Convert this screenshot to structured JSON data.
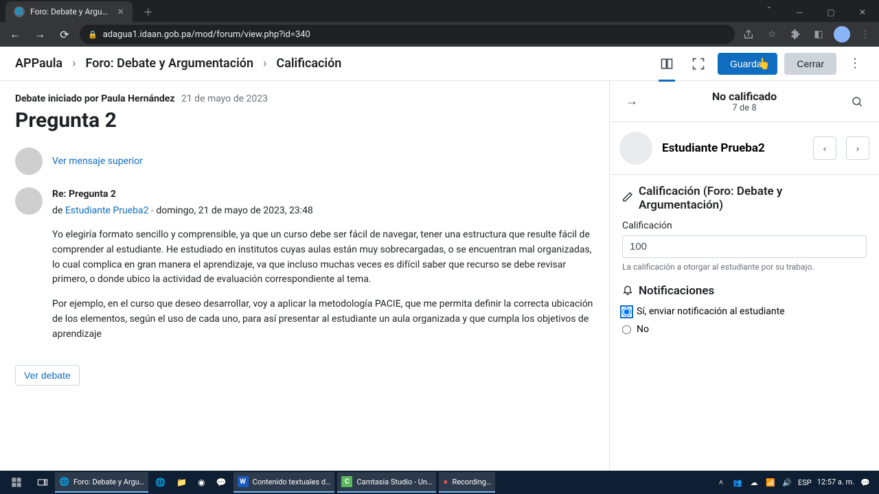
{
  "browser": {
    "tab_title": "Foro: Debate y Argu…",
    "url": "adagua1.idaan.gob.pa/mod/forum/view.php?id=340"
  },
  "breadcrumb": {
    "course": "APPaula",
    "activity": "Foro: Debate y Argumentación",
    "page": "Calificación"
  },
  "actions": {
    "save": "Guardar",
    "close": "Cerrar"
  },
  "debate": {
    "starter_label": "Debate iniciado por Paula Hernández",
    "start_date": "21 de mayo de 2023",
    "title": "Pregunta 2",
    "view_parent": "Ver mensaje superior"
  },
  "post": {
    "subject": "Re: Pregunta 2",
    "by_prefix": "de",
    "author": "Estudiante Prueba2",
    "datetime": "domingo, 21 de mayo de 2023, 23:48",
    "paragraph1": "Yo elegiría formato sencillo y comprensible, ya que un curso debe ser fácil de navegar, tener una estructura que resulte fácil de comprender al estudiante. He estudiado en institutos cuyas aulas están muy sobrecargadas, o se encuentran mal organizadas, lo cual complica en gran manera el aprendizaje, va que incluso muchas veces es difícil saber que recurso se debe revisar primero, o donde ubico la actividad de evaluación correspondiente al tema.",
    "paragraph2": "Por ejemplo, en el curso que deseo desarrollar, voy a aplicar la metodología PACIE, que me permita definir la correcta ubicación de los elementos, según el uso de cada uno, para así presentar al estudiante un aula organizada y que cumpla los objetivos de aprendizaje",
    "view_debate": "Ver debate"
  },
  "side": {
    "status_title": "No calificado",
    "status_count": "7 de 8",
    "student_name": "Estudiante Prueba2",
    "grade_section_title": "Calificación (Foro: Debate y Argumentación)",
    "grade_label": "Calificación",
    "grade_value": "100",
    "grade_hint": "La calificación a otorgar al estudiante por su trabajo.",
    "notif_title": "Notificaciones",
    "notif_yes": "Sí, enviar notificación al estudiante",
    "notif_no": "No"
  },
  "taskbar": {
    "items": [
      "Foro: Debate y Argu…",
      "Contenido textuales d…",
      "Camtasia Studio - Un…",
      "Recording…"
    ],
    "lang": "ESP",
    "time": "12:57 a. m."
  }
}
